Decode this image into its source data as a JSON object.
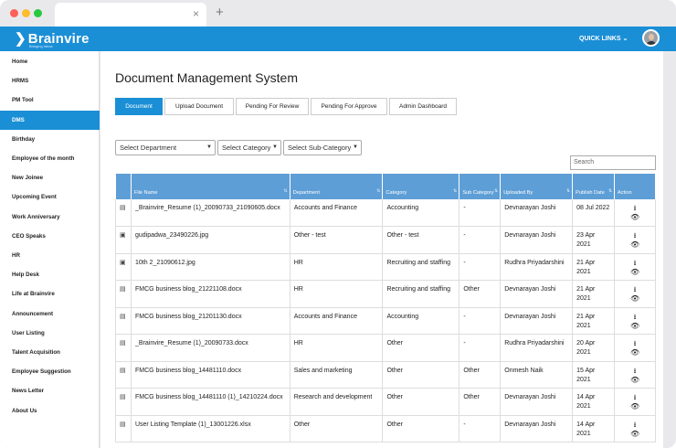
{
  "browser": {
    "tab_close": "×",
    "new_tab": "+"
  },
  "header": {
    "logo": "Brainvire",
    "tagline": "Bringing Ideas",
    "quick_links": "QUICK LINKS ⌄"
  },
  "sidebar": {
    "items": [
      "Home",
      "HRMS",
      "PM Tool",
      "DMS",
      "Birthday",
      "Employee of the month",
      "New Joinee",
      "Upcoming Event",
      "Work Anniversary",
      "CEO Speaks",
      "HR",
      "Help Desk",
      "Life at Brainvire",
      "Announcement",
      "User Listing",
      "Talent Acquisition",
      "Employee Suggestion",
      "News Letter",
      "About Us"
    ],
    "active": "DMS"
  },
  "page": {
    "title": "Document Management System"
  },
  "tabs": [
    "Document",
    "Upload Document",
    "Pending For Review",
    "Pending For Approve",
    "Admin Dashboard"
  ],
  "filters": {
    "department": "Select Department",
    "category": "Select Category",
    "subcategory": "Select Sub-Category"
  },
  "search": {
    "placeholder": "Search"
  },
  "table": {
    "columns": [
      "",
      "File Name",
      "Department",
      "Category",
      "Sub Category",
      "Uploaded By",
      "Publish Date",
      "Action"
    ],
    "rows": [
      {
        "icon": "doc",
        "file": "_Brainvire_Resume (1)_20090733_21090605.docx",
        "dept": "Accounts and Finance",
        "cat": "Accounting",
        "sub": "-",
        "by": "Devnarayan Joshi",
        "date": "08 Jul 2022"
      },
      {
        "icon": "img",
        "file": "gudipadwa_23490226.jpg",
        "dept": "Other - test",
        "cat": "Other - test",
        "sub": "-",
        "by": "Devnarayan Joshi",
        "date": "23 Apr 2021"
      },
      {
        "icon": "img",
        "file": "10th 2_21090612.jpg",
        "dept": "HR",
        "cat": "Recruiting and staffing",
        "sub": "-",
        "by": "Rudhra Priyadarshini",
        "date": "21 Apr 2021"
      },
      {
        "icon": "doc",
        "file": "FMCG business blog_21221108.docx",
        "dept": "HR",
        "cat": "Recruiting and staffing",
        "sub": "Other",
        "by": "Devnarayan Joshi",
        "date": "21 Apr 2021"
      },
      {
        "icon": "doc",
        "file": "FMCG business blog_21201130.docx",
        "dept": "Accounts and Finance",
        "cat": "Accounting",
        "sub": "-",
        "by": "Devnarayan Joshi",
        "date": "21 Apr 2021"
      },
      {
        "icon": "doc",
        "file": "_Brainvire_Resume (1)_20090733.docx",
        "dept": "HR",
        "cat": "Other",
        "sub": "-",
        "by": "Rudhra Priyadarshini",
        "date": "20 Apr 2021"
      },
      {
        "icon": "doc",
        "file": "FMCG business blog_14481110.docx",
        "dept": "Sales and marketing",
        "cat": "Other",
        "sub": "Other",
        "by": "Onmesh Naik",
        "date": "15 Apr 2021"
      },
      {
        "icon": "doc",
        "file": "FMCG business blog_14481110 (1)_14210224.docx",
        "dept": "Research and development",
        "cat": "Other",
        "sub": "Other",
        "by": "Devnarayan Joshi",
        "date": "14 Apr 2021"
      },
      {
        "icon": "xls",
        "file": "User Listing Template (1)_13001226.xlsx",
        "dept": "Other",
        "cat": "Other",
        "sub": "-",
        "by": "Devnarayan Joshi",
        "date": "14 Apr 2021"
      }
    ]
  },
  "colors": {
    "brand": "#1b8fd6",
    "header_row": "#5e9ed6"
  }
}
